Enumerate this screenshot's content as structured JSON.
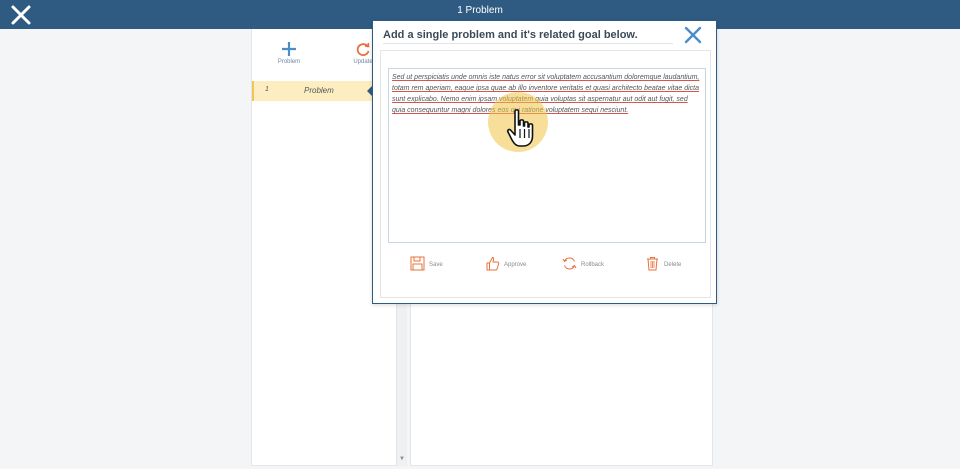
{
  "window": {
    "title": "1 Problem"
  },
  "toolbar": {
    "problem_label": "Problem",
    "update_label": "Update"
  },
  "problems": [
    {
      "number": "1",
      "label": "Problem"
    }
  ],
  "dialog": {
    "title": "Add a single problem and it's related goal below.",
    "text": "Sed ut perspiciatis unde omnis iste natus error sit voluptatem accusantium doloremque laudantium, totam rem aperiam, eaque ipsa quae ab illo inventore veritatis et quasi architecto beatae vitae dicta sunt explicabo. Nemo enim ipsam voluptatem quia voluptas sit aspernatur aut odit aut fugit, sed quia consequuntur magni dolores eos qui ratione voluptatem sequi nesciunt.",
    "actions": {
      "save": "Save",
      "approve": "Approve",
      "rollback": "Rollback",
      "delete": "Delete"
    }
  },
  "colors": {
    "topbar": "#2f5b82",
    "accent_blue": "#4a8ec9",
    "accent_orange": "#e8703a",
    "selection": "#fdeec2",
    "halo": "#f0c446"
  },
  "icons": {
    "close": "close-icon",
    "add": "plus-icon",
    "refresh": "refresh-icon",
    "save": "floppy-disk-icon",
    "approve": "thumbs-up-icon",
    "rollback": "rollback-icon",
    "delete": "trash-icon",
    "cursor": "hand-pointer-icon"
  }
}
